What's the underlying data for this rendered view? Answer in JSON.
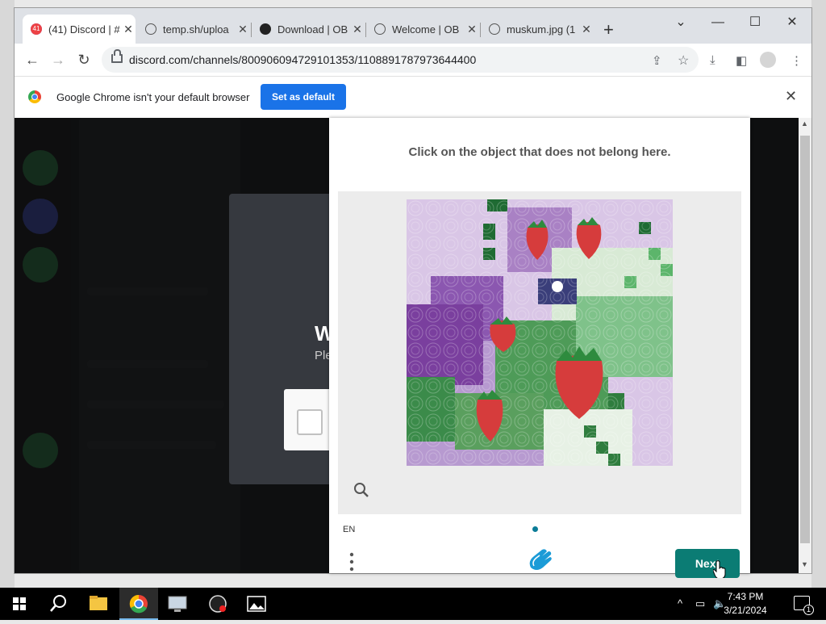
{
  "browser": {
    "tabs": [
      {
        "title": "(41) Discord | #",
        "favicon": "discord-badge-icon",
        "badge": "41",
        "active": true
      },
      {
        "title": "temp.sh/uploa",
        "favicon": "globe-icon",
        "active": false
      },
      {
        "title": "Download | OB",
        "favicon": "obs-icon",
        "active": false
      },
      {
        "title": "Welcome | OB",
        "favicon": "globe-icon",
        "active": false
      },
      {
        "title": "muskum.jpg (1",
        "favicon": "globe-icon",
        "active": false
      }
    ],
    "url": "discord.com/channels/800906094729101353/1108891787973644400",
    "infobar": {
      "message": "Google Chrome isn't your default browser",
      "button_label": "Set as default"
    }
  },
  "discord_modal": {
    "heading_fragment": "W",
    "subtext_fragment": "Ple"
  },
  "captcha": {
    "prompt": "Click on the object that does not belong here.",
    "language": "EN",
    "next_label": "Next"
  },
  "taskbar": {
    "time": "7:43 PM",
    "date": "3/21/2024",
    "notification_count": "1"
  },
  "colors": {
    "set_default_button": "#1a73e8",
    "next_button": "#0b7c74",
    "captcha_dot": "#0b7c97"
  }
}
